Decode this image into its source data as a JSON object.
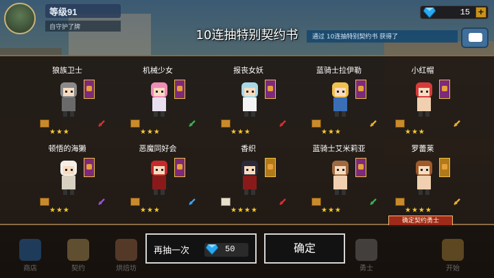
{
  "player": {
    "level": "等级91",
    "subtitle": "自守护了牌"
  },
  "gems": {
    "count": "15",
    "plus": "+"
  },
  "title": "10连抽特别契约书",
  "notice": "通过 10连抽特别契约书 获得了",
  "heroes": [
    {
      "name": "狼族卫士",
      "stars": "★★★",
      "banner": "purple",
      "weapon": "red"
    },
    {
      "name": "机械少女",
      "stars": "★★★",
      "banner": "purple",
      "weapon": "green"
    },
    {
      "name": "报丧女妖",
      "stars": "★★★",
      "banner": "purple",
      "weapon": "red"
    },
    {
      "name": "蓝骑士拉伊勒",
      "stars": "★★★",
      "banner": "purple",
      "weapon": "gold"
    },
    {
      "name": "小红帽",
      "stars": "★★★",
      "banner": "purple",
      "weapon": "gold"
    },
    {
      "name": "顿悟的海獭",
      "stars": "★★★",
      "banner": "purple",
      "weapon": "purple"
    },
    {
      "name": "恶魔同好会",
      "stars": "★★★",
      "banner": "purple",
      "weapon": "blue"
    },
    {
      "name": "香织",
      "stars": "★★★★",
      "banner": "gold",
      "weapon": "red"
    },
    {
      "name": "蓝骑士艾米莉亚",
      "stars": "★★★",
      "banner": "purple",
      "weapon": "green"
    },
    {
      "name": "罗蕾莱",
      "stars": "★★★★",
      "banner": "gold",
      "weapon": "gold"
    }
  ],
  "confirm_tag": "确定契约勇士",
  "nav": [
    "商店",
    "契约",
    "烘焙坊",
    "",
    "",
    "",
    "",
    "勇士",
    "开始"
  ],
  "retry": {
    "label": "再抽一次",
    "cost": "50"
  },
  "ok_label": "确定",
  "colors": {
    "star": "#f5c832",
    "gem": "#2aa9f0",
    "panel_border": "#8a6b45"
  }
}
